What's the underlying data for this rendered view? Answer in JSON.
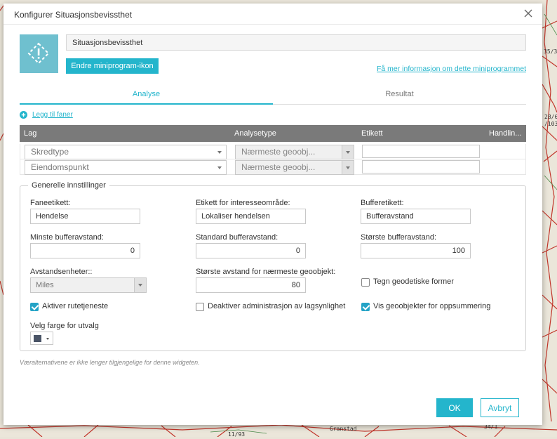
{
  "dialog": {
    "title": "Konfigurer Situasjonsbevissthet",
    "widget_name": "Situasjonsbevissthet",
    "change_icon_label": "Endre miniprogram-ikon",
    "info_link": "Få mer informasjon om dette miniprogrammet",
    "tabs": [
      {
        "label": "Analyse",
        "active": true
      },
      {
        "label": "Resultat",
        "active": false
      }
    ],
    "add_tab_label": "Legg til faner",
    "table": {
      "headers": [
        "Lag",
        "Analysetype",
        "Etikett",
        "Handlin..."
      ],
      "rows": [
        {
          "layer": "Skredtype",
          "analysis": "Nærmeste geoobj...",
          "label": ""
        },
        {
          "layer": "Eiendomspunkt",
          "analysis": "Nærmeste geoobj...",
          "label": ""
        }
      ]
    },
    "general": {
      "legend": "Generelle innstillinger",
      "tab_label_caption": "Faneetikett:",
      "tab_label_value": "Hendelse",
      "aoi_label_caption": "Etikett for interesseområde:",
      "aoi_label_value": "Lokaliser hendelsen",
      "buffer_label_caption": "Bufferetikett:",
      "buffer_label_value": "Bufferavstand",
      "min_buffer_caption": "Minste bufferavstand:",
      "min_buffer_value": "0",
      "default_buffer_caption": "Standard bufferavstand:",
      "default_buffer_value": "0",
      "max_buffer_caption": "Største bufferavstand:",
      "max_buffer_value": "100",
      "units_caption": "Avstandsenheter::",
      "units_value": "Miles",
      "max_nearest_caption": "Største avstand for nærmeste geoobjekt:",
      "max_nearest_value": "80",
      "geodesic_label": "Tegn geodetiske former",
      "geodesic_checked": false,
      "routing_label": "Aktiver rutetjeneste",
      "routing_checked": true,
      "disable_layer_label": "Deaktiver administrasjon av lagsynlighet",
      "disable_layer_checked": false,
      "summary_label": "Vis geoobjekter for oppsummering",
      "summary_checked": true,
      "color_caption": "Velg farge for utvalg",
      "color_value": "#4a5466"
    },
    "note": "Væralternativene er ikke lenger tilgjengelige for denne widgeten.",
    "ok_label": "OK",
    "cancel_label": "Avbryt"
  },
  "map_labels": [
    "35/3",
    "28/6",
    "/103",
    "Granstad",
    "34/1",
    "11/93"
  ],
  "colors": {
    "accent": "#24b5cc",
    "map_lines": "#c2362b"
  }
}
